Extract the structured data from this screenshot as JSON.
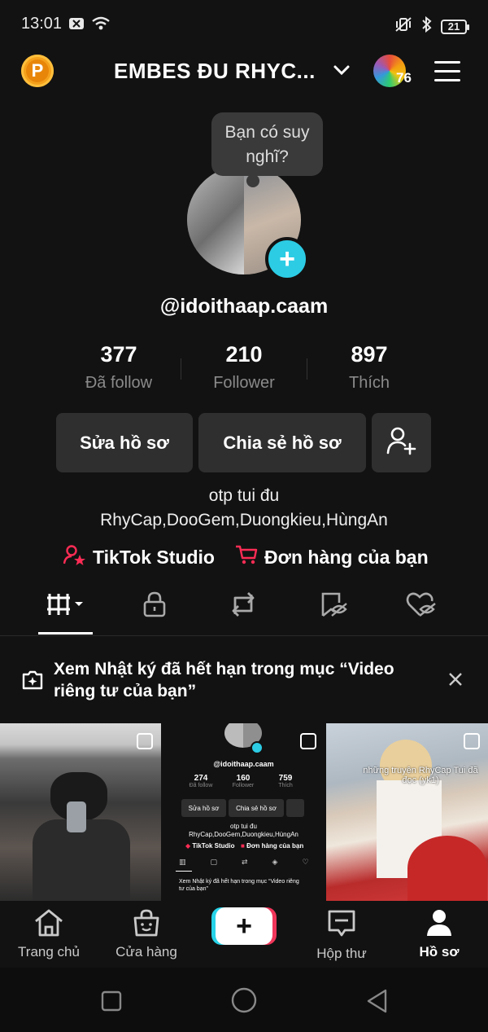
{
  "status_bar": {
    "time": "13:01",
    "battery": "21"
  },
  "header": {
    "account_name": "EMBES ĐU RHYC...",
    "avatar_badge": "76"
  },
  "profile": {
    "thought_bubble": "Bạn có suy nghĩ?",
    "handle": "@idoithaap.caam",
    "stats": [
      {
        "value": "377",
        "label": "Đã follow"
      },
      {
        "value": "210",
        "label": "Follower"
      },
      {
        "value": "897",
        "label": "Thích"
      }
    ],
    "buttons": {
      "edit": "Sửa hồ sơ",
      "share": "Chia sẻ hồ sơ"
    },
    "bio_line1": "otp tui đu",
    "bio_line2": "RhyCap,DooGem,Duongkieu,HùngAn",
    "links": {
      "studio": "TikTok Studio",
      "orders": "Đơn hàng của bạn"
    }
  },
  "notice": {
    "text": "Xem Nhật ký đã hết hạn trong mục “Video riêng tư của bạn”"
  },
  "thumbnails": {
    "mini_profile": {
      "handle": "@idoithaap.caam",
      "stats": [
        {
          "value": "274",
          "label": "Đã follow"
        },
        {
          "value": "160",
          "label": "Follower"
        },
        {
          "value": "759",
          "label": "Thích"
        }
      ],
      "edit": "Sửa hồ sơ",
      "share": "Chia sẻ hồ sơ",
      "bio_line1": "otp tui đu",
      "bio_line2": "RhyCap,DooGem,Duongkieu,HùngAn",
      "studio": "TikTok Studio",
      "orders": "Đơn hàng của bạn",
      "notice": "Xem Nhật ký đã hết hạn trong mục “Video riêng tư của bạn”"
    },
    "third_caption": "những truyện RhyCap Tui đã đọc (yk1)"
  },
  "bottom_nav": [
    {
      "label": "Trang chủ"
    },
    {
      "label": "Cửa hàng"
    },
    {
      "label": "Hộp thư"
    },
    {
      "label": "Hồ sơ"
    }
  ],
  "colors": {
    "accent_cyan": "#2ccce4",
    "accent_red": "#fe2c55",
    "coin": "#f5a11c"
  }
}
